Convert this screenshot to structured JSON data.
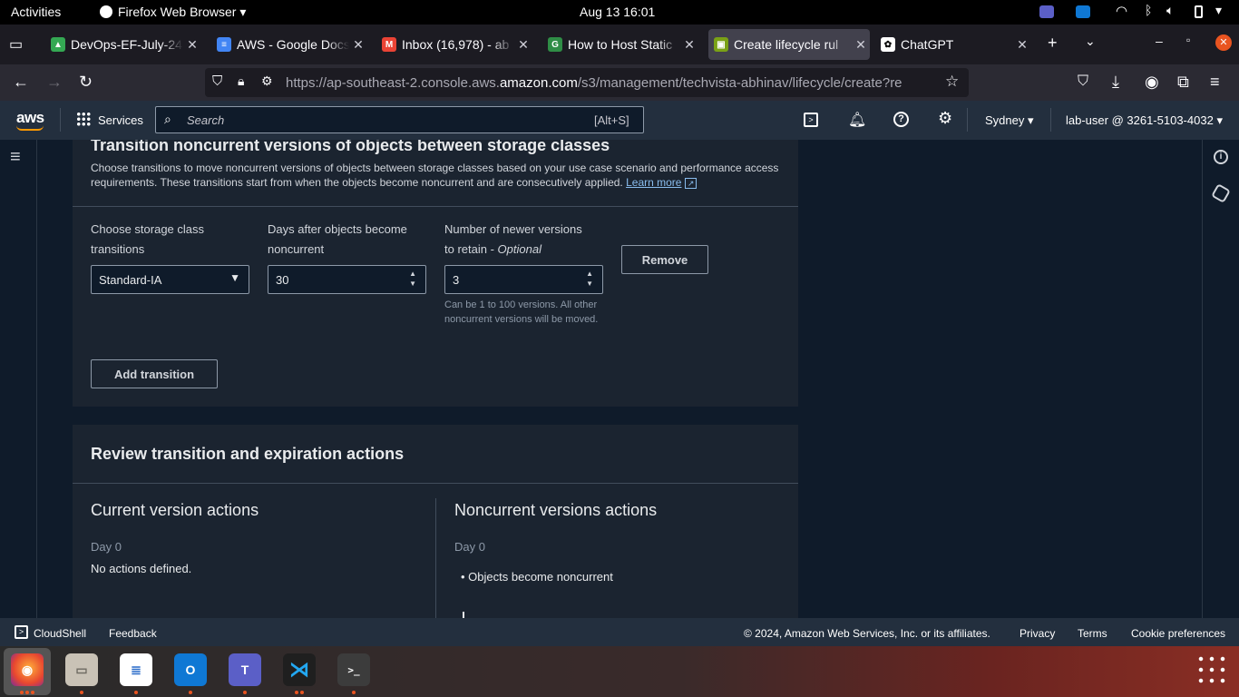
{
  "topbar": {
    "activities": "Activities",
    "app": "Firefox Web Browser",
    "clock": "Aug 13  16:01"
  },
  "tabs": [
    {
      "label": "DevOps-EF-July-24",
      "color": "#34a853"
    },
    {
      "label": "AWS - Google Docs",
      "color": "#4285f4"
    },
    {
      "label": "Inbox (16,978) - ab",
      "color": "#ea4335"
    },
    {
      "label": "How to Host Static",
      "color": "#2f8d46"
    },
    {
      "label": "Create lifecycle rul",
      "color": "#7aa116"
    },
    {
      "label": "ChatGPT",
      "color": "#ffffff"
    }
  ],
  "url": {
    "prefix": "https://ap-southeast-2.console.aws.",
    "domain": "amazon.com",
    "path": "/s3/management/techvista-abhinav/lifecycle/create?re"
  },
  "aws": {
    "logo": "aws",
    "services": "Services",
    "search_placeholder": "Search",
    "search_shortcut": "[Alt+S]",
    "region": "Sydney",
    "account": "lab-user @ 3261-5103-4032"
  },
  "transition": {
    "title": "Transition noncurrent versions of objects between storage classes",
    "desc": "Choose transitions to move noncurrent versions of objects between storage classes based on your use case scenario and performance access requirements. These transitions start from when the objects become noncurrent and are consecutively applied.",
    "learn_more": "Learn more",
    "storage_label_1": "Choose storage class",
    "storage_label_2": "transitions",
    "storage_value": "Standard-IA",
    "days_label_1": "Days after objects become",
    "days_label_2": "noncurrent",
    "days_value": "30",
    "versions_label_1": "Number of newer versions",
    "versions_label_2": "to retain - ",
    "versions_optional": "Optional",
    "versions_value": "3",
    "versions_hint": "Can be 1 to 100 versions. All other noncurrent versions will be moved.",
    "remove": "Remove",
    "add": "Add transition"
  },
  "review": {
    "title": "Review transition and expiration actions",
    "current_title": "Current version actions",
    "current_day": "Day 0",
    "current_none": "No actions defined.",
    "noncurrent_title": "Noncurrent versions actions",
    "noncurrent_day": "Day 0",
    "noncurrent_item": "Objects become noncurrent"
  },
  "footer": {
    "cloudshell": "CloudShell",
    "feedback": "Feedback",
    "copyright": "© 2024, Amazon Web Services, Inc. or its affiliates.",
    "privacy": "Privacy",
    "terms": "Terms",
    "cookies": "Cookie preferences"
  }
}
